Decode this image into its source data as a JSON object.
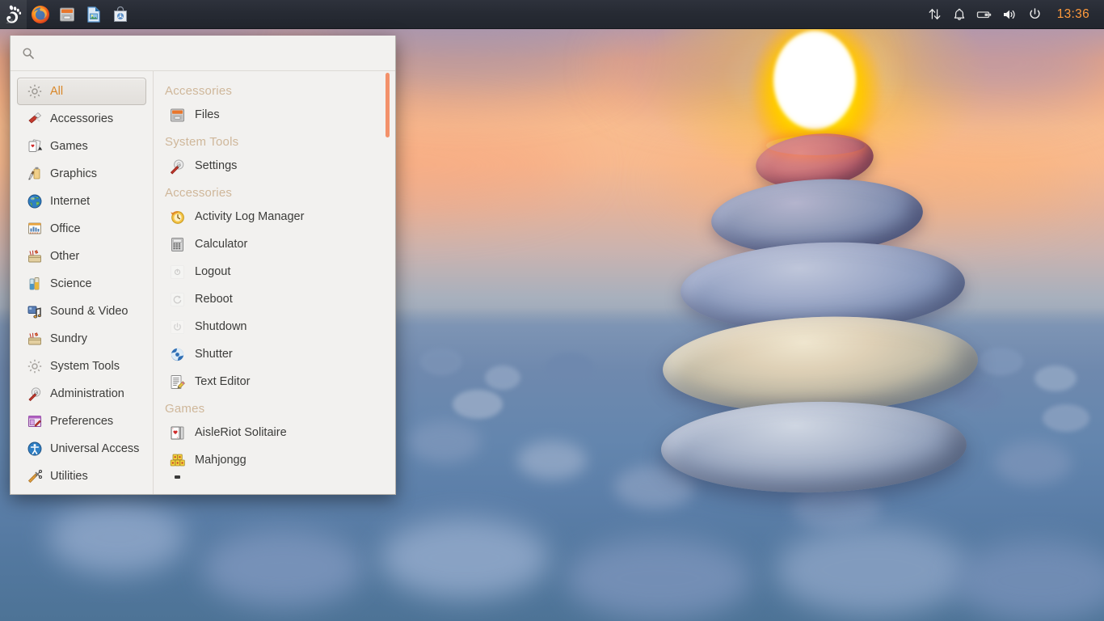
{
  "panel": {
    "launchers": [
      {
        "name": "gnome-foot-logo",
        "label": "GNOME"
      },
      {
        "name": "firefox-icon",
        "label": "Firefox Web Browser"
      },
      {
        "name": "file-manager-icon",
        "label": "Files"
      },
      {
        "name": "document-viewer-icon",
        "label": "Document Viewer"
      },
      {
        "name": "software-center-icon",
        "label": "Software"
      }
    ],
    "tray": [
      {
        "name": "network-icon",
        "label": "Network"
      },
      {
        "name": "notification-bell-icon",
        "label": "Notifications"
      },
      {
        "name": "battery-icon",
        "label": "Battery"
      },
      {
        "name": "volume-icon",
        "label": "Volume"
      },
      {
        "name": "power-icon",
        "label": "Power"
      }
    ],
    "clock": "13:36",
    "clock_color": "#ff9a3c"
  },
  "menu": {
    "search": {
      "value": "",
      "placeholder": ""
    },
    "categories": [
      {
        "label": "All",
        "icon": "gear-icon",
        "active": true
      },
      {
        "label": "Accessories",
        "icon": "accessories-icon",
        "active": false
      },
      {
        "label": "Games",
        "icon": "games-cards-icon",
        "active": false
      },
      {
        "label": "Graphics",
        "icon": "graphics-icon",
        "active": false
      },
      {
        "label": "Internet",
        "icon": "globe-icon",
        "active": false
      },
      {
        "label": "Office",
        "icon": "office-icon",
        "active": false
      },
      {
        "label": "Other",
        "icon": "other-toolbox-icon",
        "active": false
      },
      {
        "label": "Science",
        "icon": "science-flask-icon",
        "active": false
      },
      {
        "label": "Sound & Video",
        "icon": "sound-video-icon",
        "active": false
      },
      {
        "label": "Sundry",
        "icon": "sundry-toolbox-icon",
        "active": false
      },
      {
        "label": "System Tools",
        "icon": "system-gear-icon",
        "active": false
      },
      {
        "label": "Administration",
        "icon": "administration-icon",
        "active": false
      },
      {
        "label": "Preferences",
        "icon": "preferences-icon",
        "active": false
      },
      {
        "label": "Universal Access",
        "icon": "universal-access-icon",
        "active": false
      },
      {
        "label": "Utilities",
        "icon": "utilities-ruler-icon",
        "active": false
      }
    ],
    "groups": [
      {
        "header": "Accessories",
        "apps": [
          {
            "label": "Files",
            "icon": "file-cabinet-icon"
          }
        ]
      },
      {
        "header": "System Tools",
        "apps": [
          {
            "label": "Settings",
            "icon": "settings-gear-icon"
          }
        ]
      },
      {
        "header": "Accessories",
        "apps": [
          {
            "label": "Activity Log Manager",
            "icon": "clock-history-icon"
          },
          {
            "label": "Calculator",
            "icon": "calculator-icon"
          },
          {
            "label": "Logout",
            "icon": "logout-icon"
          },
          {
            "label": "Reboot",
            "icon": "reboot-icon"
          },
          {
            "label": "Shutdown",
            "icon": "shutdown-icon"
          },
          {
            "label": "Shutter",
            "icon": "shutter-icon"
          },
          {
            "label": "Text Editor",
            "icon": "text-editor-icon"
          }
        ]
      },
      {
        "header": "Games",
        "apps": [
          {
            "label": "AisleRiot Solitaire",
            "icon": "solitaire-cards-icon"
          },
          {
            "label": "Mahjongg",
            "icon": "mahjongg-tiles-icon"
          }
        ]
      }
    ],
    "scrollbar_color": "#f3916a"
  }
}
